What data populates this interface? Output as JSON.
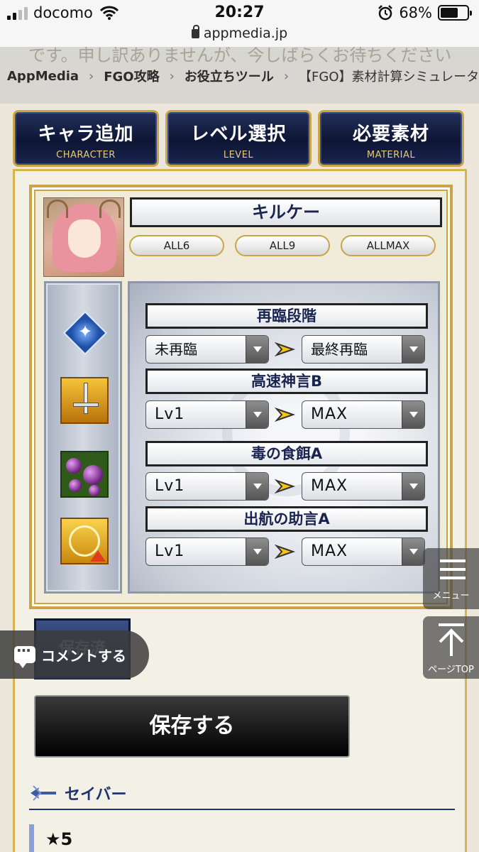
{
  "status": {
    "carrier": "docomo",
    "time": "20:27",
    "battery": "68%",
    "battery_level": 0.68
  },
  "url": "appmedia.jp",
  "breadcrumb": {
    "ghost_text": "です。申し訳ありませんが、今しばらくお待ちください",
    "items": [
      "AppMedia",
      "FGO攻略",
      "お役立ちツール",
      "【FGO】素材計算シミュレータ"
    ]
  },
  "tabs": [
    {
      "title": "キャラ追加",
      "sub": "CHARACTER"
    },
    {
      "title": "レベル選択",
      "sub": "LEVEL"
    },
    {
      "title": "必要素材",
      "sub": "MATERIAL"
    }
  ],
  "character": {
    "name": "キルケー",
    "all_buttons": [
      "ALL6",
      "ALL9",
      "ALLMAX"
    ]
  },
  "rows": [
    {
      "label": "再臨段階",
      "from": "未再臨",
      "to": "最終再臨",
      "icon": "ascension-icon"
    },
    {
      "label": "高速神言B",
      "from": "Lv1",
      "to": "MAX",
      "icon": "sword-skill-icon"
    },
    {
      "label": "毒の食餌A",
      "from": "Lv1",
      "to": "MAX",
      "icon": "poison-skill-icon"
    },
    {
      "label": "出航の助言A",
      "from": "Lv1",
      "to": "MAX",
      "icon": "buff-skill-icon"
    }
  ],
  "buttons": {
    "saved": "保存済",
    "save": "保存する"
  },
  "class_section": {
    "name": "セイバー",
    "rarity": "★5"
  },
  "floating": {
    "menu": "メニュー",
    "page_top": "ページTOP",
    "comment": "コメントする"
  },
  "colors": {
    "gold": "#c9a548",
    "navy": "#1a2450",
    "tab_bg": "#0d1533"
  }
}
